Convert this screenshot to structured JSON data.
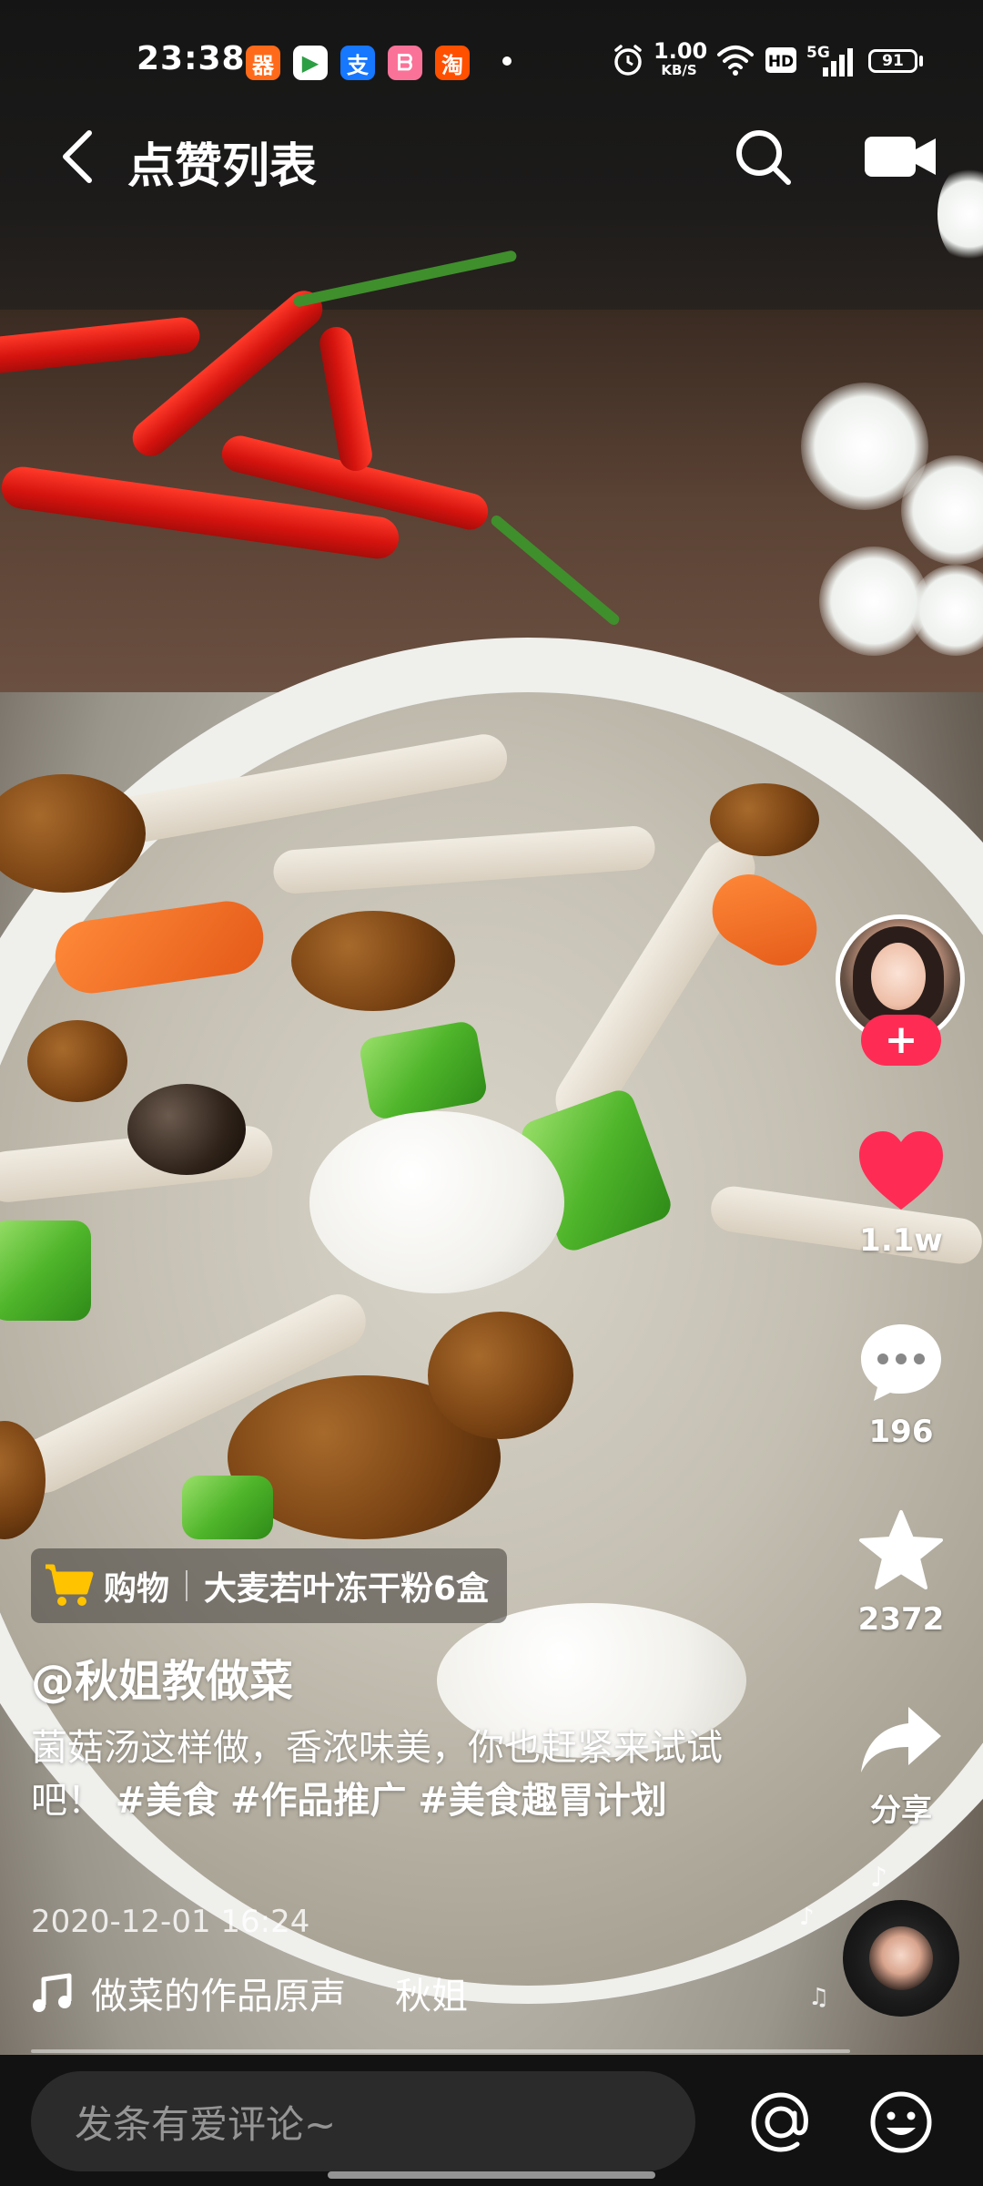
{
  "status_bar": {
    "time": "23:38",
    "apps": [
      {
        "icon": "kuaishou-icon",
        "glyph": "器",
        "color": "#ff6a1a"
      },
      {
        "icon": "play-store-icon",
        "glyph": "▶",
        "color": "#2c9f45"
      },
      {
        "icon": "alipay-icon",
        "glyph": "支",
        "color": "#1677ff"
      },
      {
        "icon": "bilibili-icon",
        "glyph": "ᗷ",
        "color": "#fb7299"
      },
      {
        "icon": "taobao-icon",
        "glyph": "淘",
        "color": "#ff5000"
      }
    ],
    "net_speed_value": "1.00",
    "net_speed_unit": "KB/S",
    "network": "5G",
    "battery": "91"
  },
  "nav": {
    "title": "点赞列表"
  },
  "right_rail": {
    "like_count": "1.1w",
    "comment_count": "196",
    "favorite_count": "2372",
    "share_label": "分享",
    "follow_symbol": "+"
  },
  "video": {
    "shop_label": "购物",
    "shop_product": "大麦若叶冻干粉6盒",
    "author": "@秋姐教做菜",
    "description_text": "菌菇汤这样做，香浓味美，你也赶紧来试试吧！",
    "hashtags": [
      "#美食",
      "#作品推广",
      "#美食趣胃计划"
    ],
    "date": "2020-12-01 16:24",
    "music_track": "做菜的作品原声",
    "music_artist": "秋姐"
  },
  "comment_bar": {
    "placeholder": "发条有爱评论~"
  },
  "colors": {
    "accent": "#fe2c55",
    "like_red": "#fe2c55",
    "bar_bg": "#121212"
  }
}
